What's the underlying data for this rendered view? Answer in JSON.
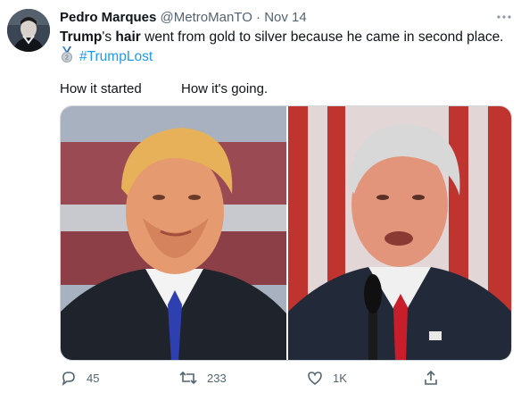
{
  "tweet": {
    "display_name": "Pedro Marques",
    "handle": "@MetroManTO",
    "separator": "·",
    "date": "Nov 14",
    "text_part1": "Trump",
    "text_part2": "'s ",
    "text_part3": "hair",
    "text_part4": " went from gold to silver because he came in second place.",
    "medal_icon": "silver-medal-icon",
    "hashtag": "#TrumpLost",
    "caption_left": "How it started",
    "caption_right": "How it's going."
  },
  "actions": {
    "reply_count": "45",
    "retweet_count": "233",
    "like_count": "1K"
  },
  "colors": {
    "accent": "#1d9bf0",
    "muted": "#536471",
    "text": "#0f1419"
  }
}
